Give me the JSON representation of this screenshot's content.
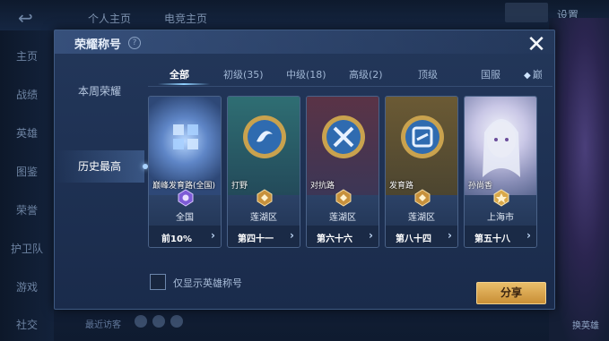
{
  "background": {
    "tabs": [
      "个人主页",
      "电竞主页"
    ],
    "settings_label": "设置",
    "sidebar": [
      "主页",
      "战绩",
      "英雄",
      "图鉴",
      "荣誉",
      "护卫队",
      "游戏",
      "社交"
    ],
    "chat_label": "最近访客",
    "change_hero_label": "换英雄"
  },
  "modal": {
    "title": "荣耀称号",
    "help_icon": "?",
    "close_icon": "✕",
    "nav": [
      {
        "label": "本周荣耀"
      },
      {
        "label": "历史最高"
      }
    ],
    "tabs": [
      {
        "label": "全部"
      },
      {
        "label": "初级(35)"
      },
      {
        "label": "中级(18)"
      },
      {
        "label": "高级(2)"
      },
      {
        "label": "顶级"
      },
      {
        "label": "国服"
      },
      {
        "label": "巅"
      }
    ],
    "cards": [
      {
        "title": "巅峰发育路(全国)",
        "region": "全国",
        "rank": "前10%"
      },
      {
        "title": "打野",
        "region": "莲湖区",
        "rank": "第四十一"
      },
      {
        "title": "对抗路",
        "region": "莲湖区",
        "rank": "第六十六"
      },
      {
        "title": "发育路",
        "region": "莲湖区",
        "rank": "第八十四"
      },
      {
        "title": "孙尚香",
        "region": "上海市",
        "rank": "第五十八"
      }
    ],
    "checkbox_label": "仅显示英雄称号",
    "share_label": "分享"
  },
  "colors": {
    "accent_gold": "#e9be6a",
    "panel_bg": "#1e3153",
    "active_text": "#ffffff"
  }
}
